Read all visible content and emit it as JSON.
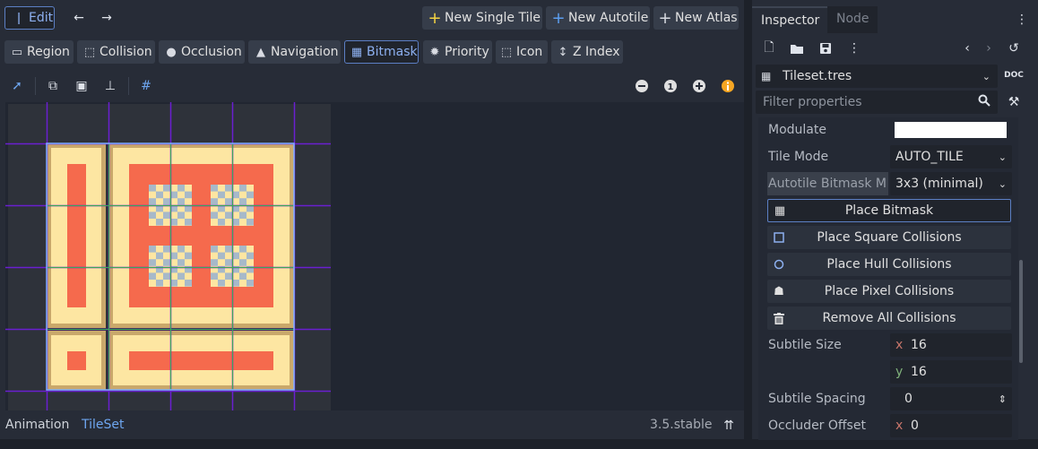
{
  "top_toolbar": {
    "edit_label": "Edit",
    "new_single_tile": "New Single Tile",
    "new_autotile": "New Autotile",
    "new_atlas": "New Atlas"
  },
  "mode_tabs": [
    {
      "label": "Region",
      "icon": "region-icon"
    },
    {
      "label": "Collision",
      "icon": "collision-icon"
    },
    {
      "label": "Occlusion",
      "icon": "occlusion-icon"
    },
    {
      "label": "Navigation",
      "icon": "navigation-icon"
    },
    {
      "label": "Bitmask",
      "icon": "bitmask-icon",
      "active": true
    },
    {
      "label": "Priority",
      "icon": "priority-icon"
    },
    {
      "label": "Icon",
      "icon": "icon-mode-icon"
    },
    {
      "label": "Z Index",
      "icon": "z-index-icon"
    }
  ],
  "zoom_controls": {
    "reset_label": "1"
  },
  "bottom_bar": {
    "animation_tab": "Animation",
    "tileset_tab": "TileSet",
    "version": "3.5.stable"
  },
  "inspector": {
    "tab_inspector": "Inspector",
    "tab_node": "Node",
    "resource_name": "Tileset.tres",
    "filter_placeholder": "Filter properties",
    "properties": {
      "modulate_label": "Modulate",
      "modulate_color": "#ffffff",
      "tile_mode_label": "Tile Mode",
      "tile_mode_value": "AUTO_TILE",
      "autotile_bitmask_label": "Autotile Bitmask M",
      "autotile_bitmask_value": "3x3 (minimal)",
      "subtile_size_label": "Subtile Size",
      "subtile_size_x_axis": "x",
      "subtile_size_x": "16",
      "subtile_size_y_axis": "y",
      "subtile_size_y": "16",
      "subtile_spacing_label": "Subtile Spacing",
      "subtile_spacing_value": "0",
      "occluder_offset_label": "Occluder Offset",
      "occluder_offset_x_axis": "x",
      "occluder_offset_x": "0"
    },
    "actions": [
      {
        "label": "Place Bitmask",
        "icon": "grid-icon",
        "active": true
      },
      {
        "label": "Place Square Collisions",
        "icon": "square-icon"
      },
      {
        "label": "Place Hull Collisions",
        "icon": "circle-icon"
      },
      {
        "label": "Place Pixel Collisions",
        "icon": "pixel-collision-icon"
      },
      {
        "label": "Remove All Collisions",
        "icon": "trash-icon"
      }
    ]
  },
  "colors": {
    "accent": "#5c7fc4",
    "tile_red": "#f56a4d",
    "tile_cream": "#fde6a2",
    "tile_border": "#c9a86b",
    "grid_purple": "#6a1fd0",
    "grid_green": "#3aa85a"
  }
}
